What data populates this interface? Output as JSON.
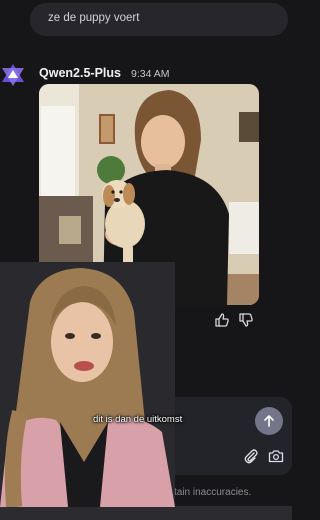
{
  "user_message": {
    "text": "ze de puppy voert"
  },
  "bot": {
    "name": "Qwen2.5-Plus",
    "time": "9:34 AM",
    "avatar_icon": "qwen-logo-icon"
  },
  "generated_image": {
    "subject": "woman-holding-puppy"
  },
  "feedback": {
    "like_icon": "thumbs-up-icon",
    "dislike_icon": "thumbs-down-icon"
  },
  "composer": {
    "send_icon": "arrow-up-icon",
    "attach_icon": "paperclip-icon",
    "camera_icon": "camera-icon"
  },
  "disclaimer": {
    "text": "tain inaccuracies."
  },
  "video_overlay": {
    "caption": "dit is dan de uitkomst"
  },
  "colors": {
    "background": "#161619",
    "bubble": "#26262c",
    "accent": "#6b4fd8",
    "send_button": "#75758a"
  }
}
